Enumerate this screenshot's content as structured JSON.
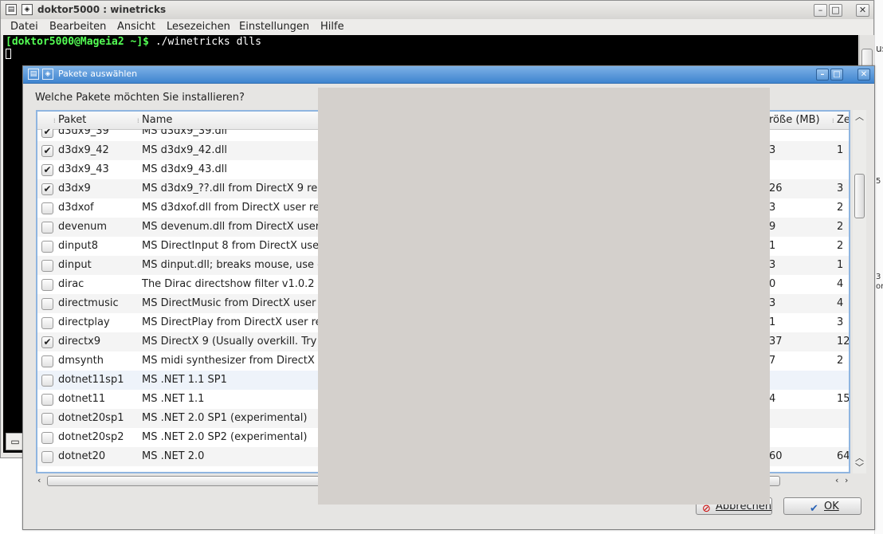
{
  "terminal": {
    "title": "doktor5000 : winetricks",
    "menu": [
      "Datei",
      "Bearbeiten",
      "Ansicht",
      "Lesezeichen",
      "Einstellungen",
      "Hilfe"
    ],
    "prompt": "[doktor5000@Mageia2 ~]$",
    "command": " ./winetricks dlls",
    "edge_texts": [
      "us",
      "5",
      "3",
      "or"
    ]
  },
  "dialog": {
    "title": "Pakete auswählen",
    "question": "Welche Pakete möchten Sie installieren?",
    "columns": {
      "paket": "Paket",
      "name": "Name",
      "size": "röße (MB)",
      "ze": "Ze"
    },
    "rows": [
      {
        "checked": true,
        "paket": "d3dx9_39",
        "name": "MS d3dx9_39.dll",
        "size": "",
        "ze": ""
      },
      {
        "checked": true,
        "paket": "d3dx9_42",
        "name": "MS d3dx9_42.dll",
        "size": "3",
        "ze": "1"
      },
      {
        "checked": true,
        "paket": "d3dx9_43",
        "name": "MS d3dx9_43.dll",
        "size": "",
        "ze": ""
      },
      {
        "checked": true,
        "paket": "d3dx9",
        "name": "MS d3dx9_??.dll from DirectX 9 redis",
        "size": "26",
        "ze": "3"
      },
      {
        "checked": false,
        "paket": "d3dxof",
        "name": "MS d3dxof.dll from DirectX user redi",
        "size": "3",
        "ze": "2"
      },
      {
        "checked": false,
        "paket": "devenum",
        "name": "MS devenum.dll from DirectX user re",
        "size": "9",
        "ze": "2"
      },
      {
        "checked": false,
        "paket": "dinput8",
        "name": "MS DirectInput 8 from DirectX user",
        "size": "1",
        "ze": "2"
      },
      {
        "checked": false,
        "paket": "dinput",
        "name": "MS dinput.dll; breaks mouse, use o",
        "size": "3",
        "ze": "1"
      },
      {
        "checked": false,
        "paket": "dirac",
        "name": "The Dirac directshow filter v1.0.2",
        "size": "0",
        "ze": "4"
      },
      {
        "checked": false,
        "paket": "directmusic",
        "name": "MS DirectMusic from DirectX user re",
        "size": "3",
        "ze": "4"
      },
      {
        "checked": false,
        "paket": "directplay",
        "name": "MS DirectPlay from DirectX user red",
        "size": "1",
        "ze": "3"
      },
      {
        "checked": true,
        "paket": "directx9",
        "name": "MS DirectX 9 (Usually overkill. Try d3",
        "size": "37",
        "ze": "12"
      },
      {
        "checked": false,
        "paket": "dmsynth",
        "name": "MS midi synthesizer from DirectX us",
        "size": "7",
        "ze": "2"
      },
      {
        "checked": false,
        "paket": "dotnet11sp1",
        "name": "MS .NET 1.1 SP1",
        "size": "",
        "ze": ""
      },
      {
        "checked": false,
        "paket": "dotnet11",
        "name": "MS .NET 1.1",
        "size": "4",
        "ze": "15"
      },
      {
        "checked": false,
        "paket": "dotnet20sp1",
        "name": "MS .NET 2.0 SP1 (experimental)",
        "size": "",
        "ze": ""
      },
      {
        "checked": false,
        "paket": "dotnet20sp2",
        "name": "MS .NET 2.0 SP2 (experimental)",
        "size": "",
        "ze": ""
      },
      {
        "checked": false,
        "paket": "dotnet20",
        "name": "MS .NET 2.0",
        "size": "60",
        "ze": "64"
      }
    ],
    "buttons": {
      "cancel": "Abbrechen",
      "ok": "OK"
    }
  },
  "icons": [
    "terminal-icon",
    "window-menu-icon",
    "minimize-icon",
    "maximize-icon",
    "close-icon",
    "checkmark-icon",
    "cancel-icon",
    "ok-check-icon"
  ]
}
